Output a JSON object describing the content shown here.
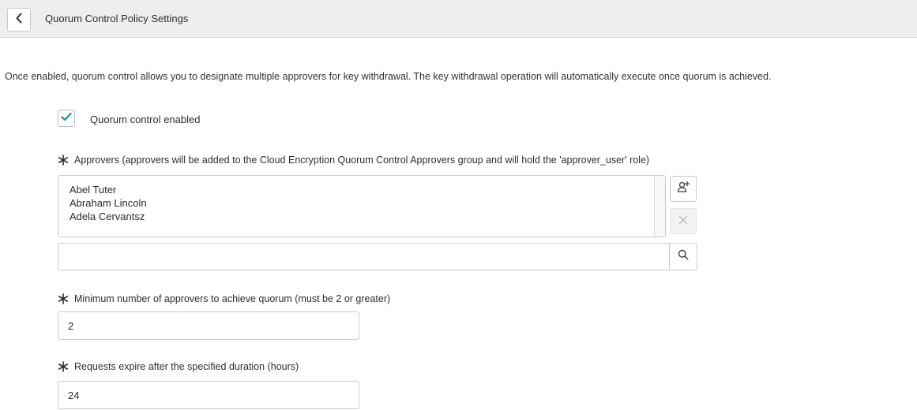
{
  "header": {
    "title": "Quorum Control Policy Settings",
    "back_icon": "chevron-left-icon"
  },
  "description": "Once enabled, quorum control allows you to designate multiple approvers for key withdrawal. The key withdrawal operation will automatically execute once quorum is achieved.",
  "quorum_toggle": {
    "checked": true,
    "label": "Quorum control enabled"
  },
  "approvers": {
    "label": "Approvers (approvers will be added to the Cloud Encryption Quorum Control Approvers group and will hold the 'approver_user' role)",
    "items": [
      "Abel Tuter",
      "Abraham Lincoln",
      "Adela Cervantsz"
    ],
    "add_icon": "add-user-icon",
    "remove_icon": "close-icon",
    "search_value": "",
    "search_icon": "search-icon"
  },
  "minimum_approvers": {
    "label": "Minimum number of approvers to achieve quorum (must be 2 or greater)",
    "value": "2"
  },
  "expiry": {
    "label": "Requests expire after the specified duration (hours)",
    "value": "24"
  },
  "colors": {
    "checkmark": "#1f8a9c",
    "header_bg": "#eceeef"
  }
}
